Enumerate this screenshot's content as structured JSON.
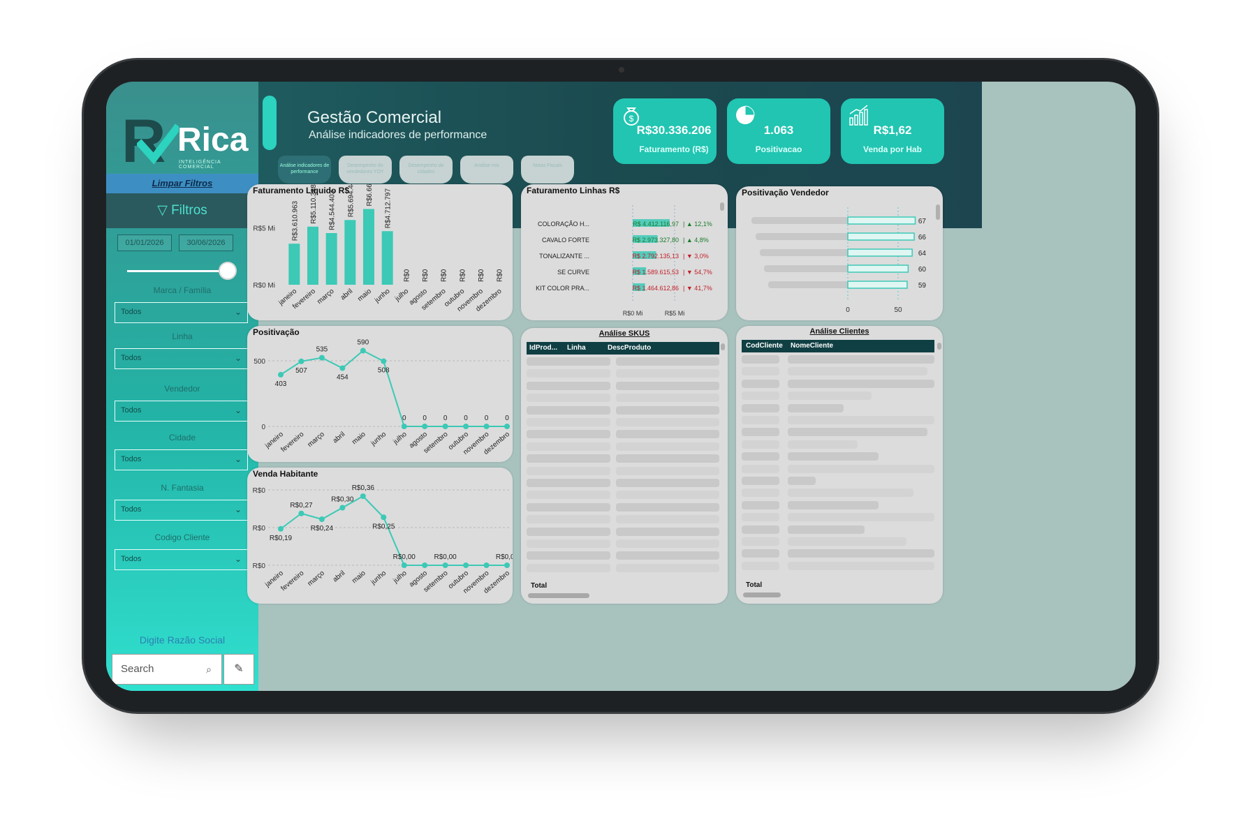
{
  "brand": {
    "logo_text": "Rica",
    "logo_sub": "INTELIGÊNCIA COMERCIAL",
    "accent": "#21c5b1",
    "dark": "#1b4a4f"
  },
  "sidebar": {
    "clear_filters": "Limpar Filtros",
    "filters_title": "▽ Filtros",
    "date_start": "01/01/2026",
    "date_end": "30/06/2026",
    "filters": [
      {
        "label": "Marca / Família",
        "value": "Todos"
      },
      {
        "label": "Linha",
        "value": "Todos"
      },
      {
        "label": "Vendedor",
        "value": "Todos"
      },
      {
        "label": "Cidade",
        "value": "Todos"
      },
      {
        "label": "N. Fantasia",
        "value": "Todos"
      },
      {
        "label": "Codigo Cliente",
        "value": "Todos"
      }
    ],
    "razao_label": "Digite Razão Social",
    "search_placeholder": "Search"
  },
  "header": {
    "title": "Gestão Comercial",
    "subtitle": "Análise indicadores de performance",
    "tabs": [
      {
        "label": "Análise indicadores de performance"
      },
      {
        "label": "Desempenho do vendedores YOY"
      },
      {
        "label": "Desempenho de cidades"
      },
      {
        "label": "Análise mix"
      },
      {
        "label": "Notas Fiscais"
      }
    ],
    "kpis": [
      {
        "value": "R$30.336.206",
        "label": "Faturamento (R$)",
        "icon": "money-bag-icon"
      },
      {
        "value": "1.063",
        "label": "Positivacao",
        "icon": "pie-chart-icon"
      },
      {
        "value": "R$1,62",
        "label": "Venda por Hab",
        "icon": "growth-chart-icon"
      }
    ]
  },
  "chart_data": [
    {
      "type": "bar",
      "title": "Faturamento Liquido R$",
      "categories": [
        "janeiro",
        "fevereiro",
        "março",
        "abril",
        "maio",
        "junho",
        "julho",
        "agosto",
        "setembro",
        "outubro",
        "novembro",
        "dezembro"
      ],
      "values": [
        3610963,
        5110388,
        4544403,
        5694441,
        6663212,
        4712797,
        0,
        0,
        0,
        0,
        0,
        0
      ],
      "data_labels": [
        "R$3.610.963",
        "R$5.110.388",
        "R$4.544.403",
        "R$5.694.441",
        "R$6.663.212",
        "R$4.712.797",
        "R$0",
        "R$0",
        "R$0",
        "R$0",
        "R$0",
        "R$0"
      ],
      "y_ticks": [
        "R$0 Mi",
        "R$5 Mi"
      ],
      "ylim": [
        0,
        7000000
      ]
    },
    {
      "type": "line",
      "title": "Positivação",
      "categories": [
        "janeiro",
        "fevereiro",
        "março",
        "abril",
        "maio",
        "junho",
        "julho",
        "agosto",
        "setembro",
        "outubro",
        "novembro",
        "dezembro"
      ],
      "values": [
        403,
        507,
        535,
        454,
        590,
        508,
        0,
        0,
        0,
        0,
        0,
        0
      ],
      "data_labels": [
        "403",
        "507",
        "535",
        "454",
        "590",
        "508",
        "0",
        "0",
        "0",
        "0",
        "0",
        "0"
      ],
      "y_ticks": [
        "0",
        "500"
      ],
      "ylim": [
        0,
        620
      ]
    },
    {
      "type": "line",
      "title": "Venda Habitante",
      "categories": [
        "janeiro",
        "fevereiro",
        "março",
        "abril",
        "maio",
        "junho",
        "julho",
        "agosto",
        "setembro",
        "outubro",
        "novembro",
        "dezembro"
      ],
      "values": [
        0.19,
        0.27,
        0.24,
        0.3,
        0.36,
        0.25,
        0,
        0,
        0,
        0,
        0,
        0
      ],
      "data_labels": [
        "R$0,19",
        "R$0,27",
        "R$0,24",
        "R$0,30",
        "R$0,36",
        "R$0,25",
        "R$0,00",
        "",
        "R$0,00",
        "",
        "",
        "R$0,00"
      ],
      "y_ticks": [
        "R$0",
        "R$0",
        "R$0"
      ],
      "ylim": [
        0,
        0.4
      ]
    },
    {
      "type": "bar",
      "title": "Faturamento Linhas R$",
      "categories": [
        "COLORAÇÃO H...",
        "CAVALO FORTE",
        "TONALIZANTE ...",
        "SE CURVE",
        "KIT COLOR PRA..."
      ],
      "values": [
        4412116.97,
        2973327.8,
        2792135.13,
        1589615.53,
        1464612.86
      ],
      "value_labels": [
        "R$ 4.412.116,97",
        "R$ 2.973.327,80",
        "R$ 2.792.135,13",
        "R$ 1.589.615,53",
        "R$ 1.464.612,86"
      ],
      "changes": [
        "▲ 12,1%",
        "▲ 4,8%",
        "▼ 3,0%",
        "▼ 54,7%",
        "▼ 41,7%"
      ],
      "change_up": [
        true,
        true,
        false,
        false,
        false
      ],
      "x_ticks": [
        "R$0 Mi",
        "R$5 Mi"
      ]
    },
    {
      "type": "bar",
      "title": "Positivação Vendedor",
      "values": [
        67,
        66,
        64,
        60,
        59
      ],
      "x_ticks": [
        "0",
        "50"
      ]
    }
  ],
  "skus": {
    "title": "Análise SKUS",
    "columns": [
      "IdProd...",
      "Linha",
      "DescProduto"
    ],
    "total_label": "Total"
  },
  "clientes": {
    "title": "Análise Clientes",
    "columns": [
      "CodCliente",
      "NomeCliente"
    ],
    "total_label": "Total"
  }
}
